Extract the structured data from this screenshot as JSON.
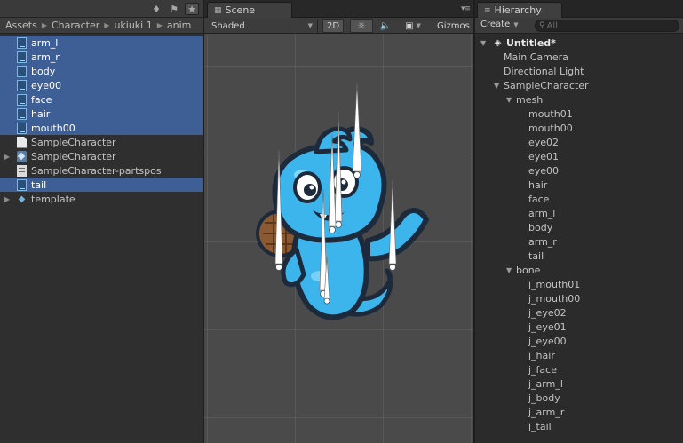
{
  "project": {
    "breadcrumb": [
      "Assets",
      "Character",
      "ukiuki 1",
      "anim"
    ],
    "files": [
      {
        "label": "arm_l",
        "icon": "sprite-icon",
        "selected": true
      },
      {
        "label": "arm_r",
        "icon": "sprite-icon",
        "selected": true
      },
      {
        "label": "body",
        "icon": "sprite-icon",
        "selected": true
      },
      {
        "label": "eye00",
        "icon": "sprite-icon",
        "selected": true
      },
      {
        "label": "face",
        "icon": "sprite-icon",
        "selected": true
      },
      {
        "label": "hair",
        "icon": "sprite-icon",
        "selected": true
      },
      {
        "label": "mouth00",
        "icon": "sprite-icon",
        "selected": true
      },
      {
        "label": "SampleCharacter",
        "icon": "document-icon",
        "selected": false
      },
      {
        "label": "SampleCharacter",
        "icon": "prefab-icon",
        "selected": false,
        "expandable": true
      },
      {
        "label": "SampleCharacter-partspos",
        "icon": "text-asset-icon",
        "selected": false
      },
      {
        "label": "tail",
        "icon": "sprite-icon",
        "selected": true
      },
      {
        "label": "template",
        "icon": "package-icon",
        "selected": false,
        "expandable": true
      }
    ]
  },
  "scene": {
    "tab_label": "Scene",
    "shading_mode": "Shaded",
    "mode_2d": "2D",
    "gizmos": "Gizmos"
  },
  "hierarchy": {
    "tab_label": "Hierarchy",
    "create_label": "Create",
    "search_placeholder": "All",
    "items": [
      {
        "label": "Untitled*",
        "depth": 0,
        "expanded": true,
        "root": true
      },
      {
        "label": "Main Camera",
        "depth": 1
      },
      {
        "label": "Directional Light",
        "depth": 1
      },
      {
        "label": "SampleCharacter",
        "depth": 1,
        "expanded": true
      },
      {
        "label": "mesh",
        "depth": 2,
        "expanded": true
      },
      {
        "label": "mouth01",
        "depth": 3
      },
      {
        "label": "mouth00",
        "depth": 3
      },
      {
        "label": "eye02",
        "depth": 3
      },
      {
        "label": "eye01",
        "depth": 3
      },
      {
        "label": "eye00",
        "depth": 3
      },
      {
        "label": "hair",
        "depth": 3
      },
      {
        "label": "face",
        "depth": 3
      },
      {
        "label": "arm_l",
        "depth": 3
      },
      {
        "label": "body",
        "depth": 3
      },
      {
        "label": "arm_r",
        "depth": 3
      },
      {
        "label": "tail",
        "depth": 3
      },
      {
        "label": "bone",
        "depth": 2,
        "expanded": true
      },
      {
        "label": "j_mouth01",
        "depth": 3
      },
      {
        "label": "j_mouth00",
        "depth": 3
      },
      {
        "label": "j_eye02",
        "depth": 3
      },
      {
        "label": "j_eye01",
        "depth": 3
      },
      {
        "label": "j_eye00",
        "depth": 3
      },
      {
        "label": "j_hair",
        "depth": 3
      },
      {
        "label": "j_face",
        "depth": 3
      },
      {
        "label": "j_arm_l",
        "depth": 3
      },
      {
        "label": "j_body",
        "depth": 3
      },
      {
        "label": "j_arm_r",
        "depth": 3
      },
      {
        "label": "j_tail",
        "depth": 3
      }
    ]
  },
  "colors": {
    "selection": "#3e5f96",
    "character_body": "#3cb4ec",
    "character_outline": "#1c2a3c",
    "shell": "#8b5a32"
  }
}
